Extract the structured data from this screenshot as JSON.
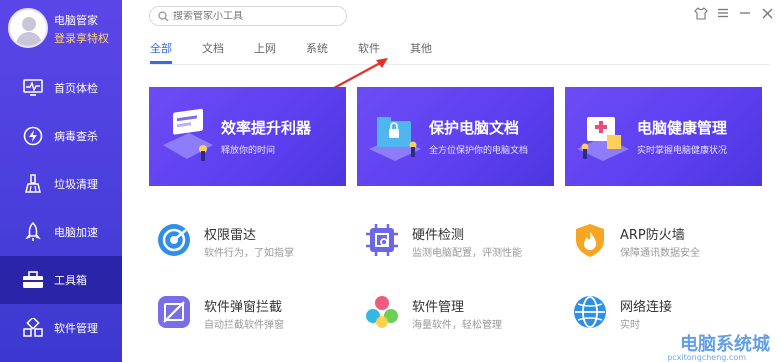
{
  "profile": {
    "name": "电脑管家",
    "login_text": "登录享特权"
  },
  "sidebar": {
    "items": [
      {
        "label": "首页体检",
        "icon": "monitor-icon"
      },
      {
        "label": "病毒查杀",
        "icon": "lightning-icon"
      },
      {
        "label": "垃圾清理",
        "icon": "broom-icon"
      },
      {
        "label": "电脑加速",
        "icon": "rocket-icon"
      },
      {
        "label": "工具箱",
        "icon": "toolbox-icon",
        "active": true
      },
      {
        "label": "软件管理",
        "icon": "software-icon"
      }
    ]
  },
  "search": {
    "placeholder": "搜索管家小工具"
  },
  "tabs": [
    "全部",
    "文档",
    "上网",
    "系统",
    "软件",
    "其他"
  ],
  "banners": [
    {
      "title": "效率提升利器",
      "subtitle": "释放你的时间"
    },
    {
      "title": "保护电脑文档",
      "subtitle": "全方位保护你的电脑文档"
    },
    {
      "title": "电脑健康管理",
      "subtitle": "实时掌握电脑健康状况"
    }
  ],
  "tools": [
    {
      "name": "权限雷达",
      "desc": "软件行为，了如指掌",
      "icon": "radar-icon",
      "color": "#2f8fe8"
    },
    {
      "name": "硬件检测",
      "desc": "监测电脑配置，评测性能",
      "icon": "chip-icon",
      "color": "#6b67e6"
    },
    {
      "name": "ARP防火墙",
      "desc": "保障通讯数据安全",
      "icon": "shield-fire-icon",
      "color": "#f6a623"
    },
    {
      "name": "软件弹窗拦截",
      "desc": "自动拦截软件弹窗",
      "icon": "block-popup-icon",
      "color": "#7a6ee8"
    },
    {
      "name": "软件管理",
      "desc": "海量软件，轻松管理",
      "icon": "software-manage-icon",
      "color": "#35b8e0"
    },
    {
      "name": "网络连接",
      "desc": "实时",
      "icon": "globe-icon",
      "color": "#2f8fe8"
    }
  ],
  "watermark": {
    "text": "电脑系统城",
    "sub": "pcxitongcheng.com"
  },
  "colors": {
    "sidebar": "#4a3fdc",
    "accent": "#3a6ae0",
    "banner": "#5d3ff0"
  }
}
